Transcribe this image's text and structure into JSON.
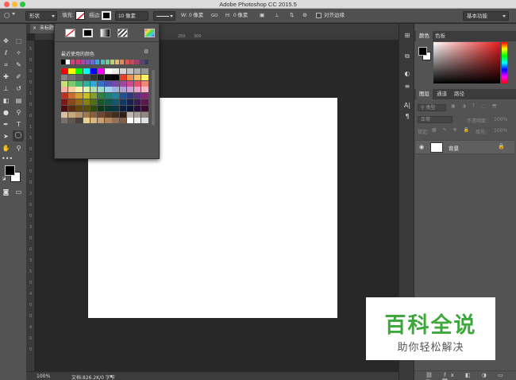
{
  "titlebar": {
    "title": "Adobe Photoshop CC 2015.5"
  },
  "options_bar": {
    "tool_mode": "形状",
    "fill_label": "填充:",
    "stroke_label": "描边:",
    "stroke_width": "10 像素",
    "w_label": "W:",
    "w_value": "0 像素",
    "go_icon": "GO",
    "h_label": "H:",
    "h_value": "0 像素",
    "align_edges_label": "对齐边缘",
    "workspace": "基本功能"
  },
  "document": {
    "tab_title": "未标题",
    "zoom": "100%",
    "doc_info": "文档:826.2K/0 字节"
  },
  "ruler_top_labels": [
    "250",
    "300"
  ],
  "ruler_left_labels": [
    "5",
    "0",
    "5",
    "0",
    "1",
    "0",
    "0",
    "1",
    "5",
    "0",
    "2",
    "0",
    "0",
    "2",
    "5",
    "0",
    "3",
    "0",
    "0",
    "3",
    "5",
    "0",
    "4",
    "0",
    "0",
    "4",
    "5",
    "0"
  ],
  "color_popup": {
    "recent_label": "最近使用的颜色",
    "recent_colors": [
      "#000000",
      "#ffffff",
      "#e43a8a",
      "#d43b73",
      "#a34aa0",
      "#7a5db0",
      "#6c6cc8",
      "#4aa0d8",
      "#4cc0b8",
      "#70cc90",
      "#b8d070",
      "#e8b868",
      "#e88858",
      "#d85858",
      "#c05060",
      "#a04070",
      "#604068",
      "#3c3c5c"
    ],
    "swatch_rows": [
      [
        "#ff0000",
        "#ffff00",
        "#00ff00",
        "#00ffff",
        "#0000ff",
        "#ff00ff",
        "#ffffff",
        "#ebebeb",
        "#d6d6d6",
        "#c2c2c2",
        "#adadad",
        "#999999"
      ],
      [
        "#858585",
        "#707070",
        "#5c5c5c",
        "#474747",
        "#333333",
        "#1f1f1f",
        "#0a0a0a",
        "#000000",
        "#e8402c",
        "#f09050",
        "#f8c060",
        "#fff070"
      ],
      [
        "#c8e070",
        "#80c870",
        "#40b870",
        "#30b0a0",
        "#30a8d8",
        "#3070c8",
        "#5050b0",
        "#7848a8",
        "#a048a0",
        "#d04890",
        "#e85070",
        "#f08878"
      ],
      [
        "#f8b0a0",
        "#f8d0a0",
        "#f8f0b0",
        "#e0f0b0",
        "#b0e0b0",
        "#a0d8d0",
        "#a0d0f0",
        "#a0b0e0",
        "#b0a0d8",
        "#d0a0d8",
        "#f0a0d0",
        "#f8b8c8"
      ],
      [
        "#c03020",
        "#c87030",
        "#d0a030",
        "#c8c020",
        "#80a030",
        "#308040",
        "#208070",
        "#2080a0",
        "#205090",
        "#303880",
        "#583080",
        "#802870"
      ],
      [
        "#801818",
        "#884818",
        "#906818",
        "#888010",
        "#507018",
        "#185828",
        "#105848",
        "#105870",
        "#103860",
        "#182050",
        "#381850",
        "#581848"
      ],
      [
        "#500c0c",
        "#582c0c",
        "#604408",
        "#585008",
        "#304808",
        "#0c3818",
        "#083830",
        "#083848",
        "#082040",
        "#0c1438",
        "#240c38",
        "#380c30"
      ],
      [
        "#d8c0a0",
        "#c8a880",
        "#b89068",
        "#a07850",
        "#886040",
        "#704830",
        "#583828",
        "#403020",
        "#302018",
        "#c0b8b0",
        "#a8a098",
        "#908880"
      ],
      [
        "#787068",
        "#605850",
        "#484038",
        "#ecd090",
        "#d8b880",
        "#c8a070",
        "#b08860",
        "#987058",
        "#806048",
        "#ffffff",
        "#f0f0f0",
        "#e0e0e0"
      ]
    ]
  },
  "panels": {
    "color_tabs": [
      "颜色",
      "色板"
    ],
    "layer_tabs": [
      "图层",
      "通道",
      "路径"
    ],
    "kind_filter": "类型",
    "blend_mode": "正常",
    "opacity_label": "不透明度:",
    "opacity_value": "100%",
    "lock_label": "锁定:",
    "fill_label": "填充:",
    "fill_value": "100%",
    "layer_name": "背景"
  },
  "colors": {
    "accent": "#e81c1c",
    "foreground": "#000000",
    "background": "#ffffff",
    "watermark_green": "#3fa83c"
  },
  "watermark": {
    "title": "百科全说",
    "subtitle": "助你轻松解决"
  }
}
